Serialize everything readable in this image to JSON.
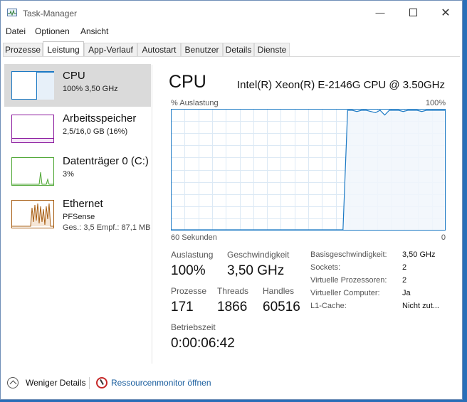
{
  "window": {
    "title": "Task-Manager"
  },
  "menu": [
    "Datei",
    "Optionen",
    "Ansicht"
  ],
  "tabs": [
    "Prozesse",
    "Leistung",
    "App-Verlauf",
    "Autostart",
    "Benutzer",
    "Details",
    "Dienste"
  ],
  "active_tab": "Leistung",
  "sidebar": {
    "items": [
      {
        "name": "CPU",
        "sub": "100% 3,50 GHz",
        "color": "#1b79c4",
        "selected": true
      },
      {
        "name": "Arbeitsspeicher",
        "sub": "2,5/16,0 GB (16%)",
        "color": "#8b1a9e"
      },
      {
        "name": "Datenträger 0 (C:)",
        "sub": "3%",
        "color": "#4da633"
      },
      {
        "name": "Ethernet",
        "sub": "PFSense",
        "sub2": "Ges.: 3,5  Empf.: 87,1 MB",
        "color": "#a75d12"
      }
    ]
  },
  "main": {
    "title": "CPU",
    "model": "Intel(R) Xeon(R) E-2146G CPU @ 3.50GHz",
    "graph": {
      "y_label": "% Auslastung",
      "y_max_label": "100%",
      "x_left_label": "60 Sekunden",
      "x_right_label": "0",
      "usage_history_percent": [
        0,
        0,
        0,
        0,
        0,
        0,
        0,
        0,
        0,
        0,
        0,
        0,
        0,
        0,
        0,
        0,
        0,
        0,
        0,
        0,
        0,
        0,
        0,
        0,
        0,
        0,
        0,
        0,
        0,
        0,
        0,
        0,
        0,
        0,
        0,
        0,
        0,
        0,
        100,
        100,
        99,
        100,
        100,
        99,
        98,
        100,
        96,
        100,
        100,
        100,
        99,
        100,
        100,
        100,
        99,
        100,
        100,
        100,
        100,
        100
      ]
    },
    "stats": {
      "utilization_label": "Auslastung",
      "utilization": "100%",
      "speed_label": "Geschwindigkeit",
      "speed": "3,50 GHz",
      "processes_label": "Prozesse",
      "processes": "171",
      "threads_label": "Threads",
      "threads": "1866",
      "handles_label": "Handles",
      "handles": "60516",
      "uptime_label": "Betriebszeit",
      "uptime": "0:00:06:42"
    },
    "info": [
      {
        "label": "Basisgeschwindigkeit:",
        "value": "3,50 GHz"
      },
      {
        "label": "Sockets:",
        "value": "2"
      },
      {
        "label": "Virtuelle Prozessoren:",
        "value": "2"
      },
      {
        "label": "Virtueller Computer:",
        "value": "Ja"
      },
      {
        "label": "L1-Cache:",
        "value": "Nicht zut..."
      }
    ]
  },
  "footer": {
    "fewer_details": "Weniger Details",
    "resource_monitor": "Ressourcenmonitor öffnen"
  },
  "colors": {
    "cpu_line": "#1b79c4",
    "cpu_fill": "#f1f6fb",
    "grid": "#dce9f5",
    "link": "#1a5e9e"
  }
}
